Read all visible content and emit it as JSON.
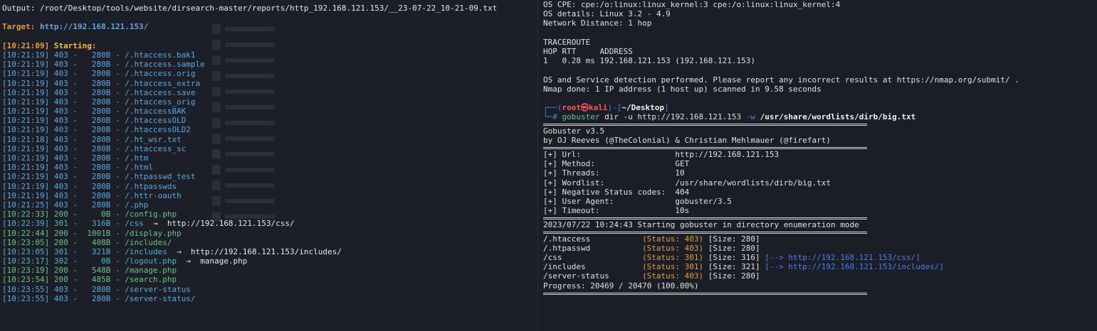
{
  "left": {
    "output_line": "Output: /root/Desktop/tools/website/dirsearch-master/reports/http_192.168.121.153/__23-07-22_10-21-09.txt",
    "target_label": "Target: ",
    "target_url": "http://192.168.121.153/",
    "start_time": "[10:21:09] ",
    "start_label": "Starting:",
    "rows": [
      {
        "time": "[10:21:19]",
        "code": "403",
        "size": "280B",
        "path": "/.htaccess.bak1",
        "redirect": "",
        "color": "blue"
      },
      {
        "time": "[10:21:19]",
        "code": "403",
        "size": "280B",
        "path": "/.htaccess.sample",
        "redirect": "",
        "color": "blue"
      },
      {
        "time": "[10:21:19]",
        "code": "403",
        "size": "280B",
        "path": "/.htaccess.orig",
        "redirect": "",
        "color": "blue"
      },
      {
        "time": "[10:21:19]",
        "code": "403",
        "size": "280B",
        "path": "/.htaccess_extra",
        "redirect": "",
        "color": "blue"
      },
      {
        "time": "[10:21:19]",
        "code": "403",
        "size": "280B",
        "path": "/.htaccess.save",
        "redirect": "",
        "color": "blue"
      },
      {
        "time": "[10:21:19]",
        "code": "403",
        "size": "280B",
        "path": "/.htaccess_orig",
        "redirect": "",
        "color": "blue"
      },
      {
        "time": "[10:21:19]",
        "code": "403",
        "size": "280B",
        "path": "/.htaccessBAK",
        "redirect": "",
        "color": "blue"
      },
      {
        "time": "[10:21:19]",
        "code": "403",
        "size": "280B",
        "path": "/.htaccessOLD",
        "redirect": "",
        "color": "blue"
      },
      {
        "time": "[10:21:19]",
        "code": "403",
        "size": "280B",
        "path": "/.htaccessOLD2",
        "redirect": "",
        "color": "blue"
      },
      {
        "time": "[10:21:18]",
        "code": "403",
        "size": "280B",
        "path": "/.ht_wsr.txt",
        "redirect": "",
        "color": "blue"
      },
      {
        "time": "[10:21:19]",
        "code": "403",
        "size": "280B",
        "path": "/.htaccess_sc",
        "redirect": "",
        "color": "blue"
      },
      {
        "time": "[10:21:19]",
        "code": "403",
        "size": "280B",
        "path": "/.htm",
        "redirect": "",
        "color": "blue"
      },
      {
        "time": "[10:21:19]",
        "code": "403",
        "size": "280B",
        "path": "/.html",
        "redirect": "",
        "color": "blue"
      },
      {
        "time": "[10:21:19]",
        "code": "403",
        "size": "280B",
        "path": "/.htpasswd_test",
        "redirect": "",
        "color": "blue"
      },
      {
        "time": "[10:21:19]",
        "code": "403",
        "size": "280B",
        "path": "/.htpasswds",
        "redirect": "",
        "color": "blue"
      },
      {
        "time": "[10:21:19]",
        "code": "403",
        "size": "280B",
        "path": "/.httr-oauth",
        "redirect": "",
        "color": "blue"
      },
      {
        "time": "[10:21:25]",
        "code": "403",
        "size": "280B",
        "path": "/.php",
        "redirect": "",
        "color": "blue"
      },
      {
        "time": "[10:22:33]",
        "code": "200",
        "size": "0B",
        "path": "/config.php",
        "redirect": "",
        "color": "green"
      },
      {
        "time": "[10:22:39]",
        "code": "301",
        "size": "316B",
        "path": "/css",
        "redirect": "http://192.168.121.153/css/",
        "color": "cyan"
      },
      {
        "time": "[10:22:44]",
        "code": "200",
        "size": "1001B",
        "path": "/display.php",
        "redirect": "",
        "color": "green"
      },
      {
        "time": "[10:23:05]",
        "code": "200",
        "size": "408B",
        "path": "/includes/",
        "redirect": "",
        "color": "green"
      },
      {
        "time": "[10:23:05]",
        "code": "301",
        "size": "321B",
        "path": "/includes",
        "redirect": "http://192.168.121.153/includes/",
        "color": "cyan"
      },
      {
        "time": "[10:23:17]",
        "code": "302",
        "size": "0B",
        "path": "/logout.php",
        "redirect": "manage.php",
        "color": "cyan"
      },
      {
        "time": "[10:23:19]",
        "code": "200",
        "size": "548B",
        "path": "/manage.php",
        "redirect": "",
        "color": "green"
      },
      {
        "time": "[10:23:54]",
        "code": "200",
        "size": "485B",
        "path": "/search.php",
        "redirect": "",
        "color": "green"
      },
      {
        "time": "[10:23:55]",
        "code": "403",
        "size": "280B",
        "path": "/server-status",
        "redirect": "",
        "color": "blue"
      },
      {
        "time": "[10:23:55]",
        "code": "403",
        "size": "280B",
        "path": "/server-status/",
        "redirect": "",
        "color": "blue"
      }
    ],
    "arrow": "→"
  },
  "right": {
    "top_lines": [
      "OS CPE: cpe:/o:linux:linux_kernel:3 cpe:/o:linux:linux_kernel:4",
      "OS details: Linux 3.2 - 4.9",
      "Network Distance: 1 hop",
      "",
      "TRACEROUTE",
      "HOP RTT     ADDRESS",
      "1   0.28 ms 192.168.121.153 (192.168.121.153)",
      "",
      "OS and Service detection performed. Please report any incorrect results at https://nmap.org/submit/ .",
      "Nmap done: 1 IP address (1 host up) scanned in 9.58 seconds"
    ],
    "prompt": {
      "open": "┌──(",
      "user": "root㉿kali",
      "mid": ")-[",
      "dir": "~/Desktop",
      "close": "]",
      "hash": "└─# ",
      "cmd1": "gobuster",
      "cmd2": " dir -u http://192.168.121.153 ",
      "flag": "-w",
      "wordlist": " /usr/share/wordlists/dirb/big.txt"
    },
    "banner": [
      "Gobuster v3.5",
      "by OJ Reeves (@TheColonial) & Christian Mehlmauer (@firefart)"
    ],
    "config": [
      {
        "key": "[+] Url:",
        "value": "http://192.168.121.153"
      },
      {
        "key": "[+] Method:",
        "value": "GET"
      },
      {
        "key": "[+] Threads:",
        "value": "10"
      },
      {
        "key": "[+] Wordlist:",
        "value": "/usr/share/wordlists/dirb/big.txt"
      },
      {
        "key": "[+] Negative Status codes:",
        "value": "404"
      },
      {
        "key": "[+] User Agent:",
        "value": "gobuster/3.5"
      },
      {
        "key": "[+] Timeout:",
        "value": "10s"
      }
    ],
    "start_line": "2023/07/22 10:24:43 Starting gobuster in directory enumeration mode",
    "results": [
      {
        "path": "/.htaccess",
        "status": "(Status: 403)",
        "size": "[Size: 280]",
        "redirect": ""
      },
      {
        "path": "/.htpasswd",
        "status": "(Status: 403)",
        "size": "[Size: 280]",
        "redirect": ""
      },
      {
        "path": "/css",
        "status": "(Status: 301)",
        "size": "[Size: 316]",
        "redirect": "[--> http://192.168.121.153/css/]"
      },
      {
        "path": "/includes",
        "status": "(Status: 301)",
        "size": "[Size: 321]",
        "redirect": "[--> http://192.168.121.153/includes/]"
      },
      {
        "path": "/server-status",
        "status": "(Status: 403)",
        "size": "[Size: 280]",
        "redirect": ""
      }
    ],
    "progress": "Progress: 20469 / 20470 (100.00%)"
  },
  "colors": {
    "blue": "#5ea7e6",
    "green": "#69c48a",
    "cyan": "#4fb3c9",
    "orange": "#e79a3f",
    "prompt_red": "#ff5a5a",
    "prompt_blue": "#4d7df5"
  }
}
